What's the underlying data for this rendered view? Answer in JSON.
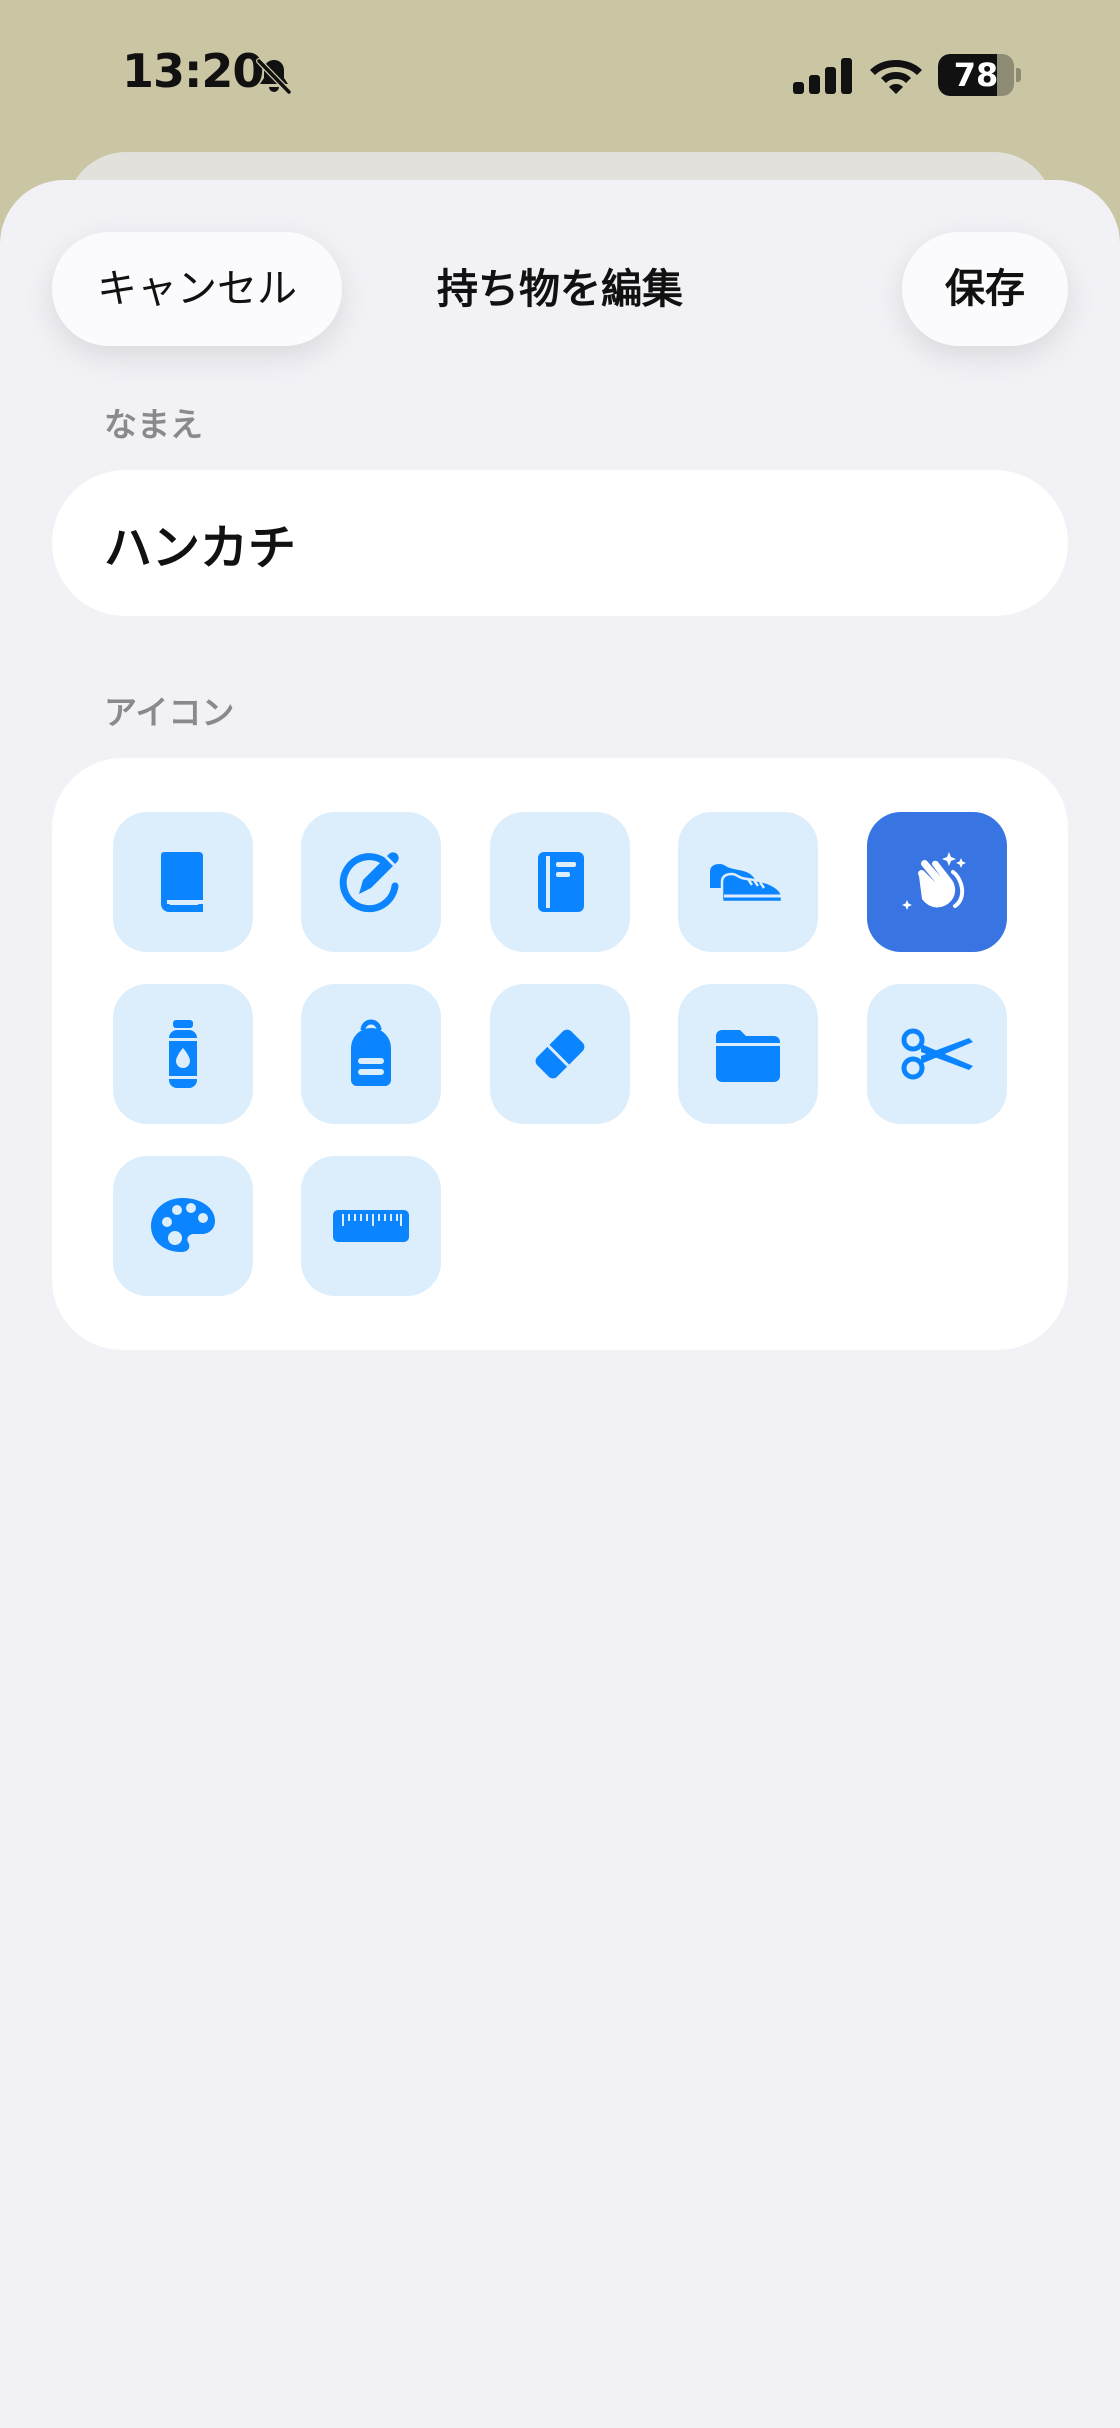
{
  "status_bar": {
    "time": "13:20",
    "battery_level": 78,
    "battery_text": "78"
  },
  "nav": {
    "cancel_label": "キャンセル",
    "title": "持ち物を編集",
    "save_label": "保存"
  },
  "name_section": {
    "label": "なまえ",
    "value": "ハンカチ"
  },
  "icon_section": {
    "label": "アイコン",
    "selected_icon": "hands-clap-sparkles-icon",
    "icons": [
      "book-icon",
      "pencil-circle-icon",
      "notebook-icon",
      "sneakers-icon",
      "hands-clap-sparkles-icon",
      "water-bottle-icon",
      "backpack-icon",
      "eraser-icon",
      "folder-icon",
      "scissors-icon",
      "paint-palette-icon",
      "ruler-icon"
    ]
  },
  "colors": {
    "accent": "#0a84ff",
    "tile_background": "#dcedfc",
    "selected_tile": "#3875e3",
    "sheet_background": "#f1f1f6",
    "wallpaper": "#cac6a4"
  }
}
